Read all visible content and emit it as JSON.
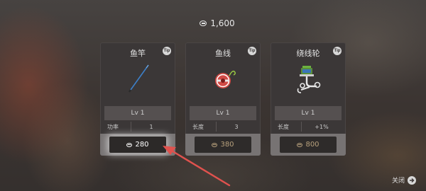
{
  "currency": {
    "icon": "coin-icon",
    "amount": "1,600"
  },
  "tip_label": "Tip",
  "cards": [
    {
      "title": "鱼竿",
      "item_icon": "fishing-rod-icon",
      "level": "Lv 1",
      "stat_name": "功率",
      "stat_value": "1",
      "cost": "280",
      "highlighted": true
    },
    {
      "title": "鱼线",
      "item_icon": "fishing-line-spool-icon",
      "level": "Lv 1",
      "stat_name": "长度",
      "stat_value": "3",
      "cost": "380",
      "highlighted": false
    },
    {
      "title": "绕线轮",
      "item_icon": "fishing-reel-icon",
      "level": "Lv 1",
      "stat_name": "长度",
      "stat_value": "+1%",
      "cost": "800",
      "highlighted": false
    }
  ],
  "close": {
    "label": "关闭",
    "icon": "arrow-right-icon"
  },
  "colors": {
    "panel": "#3b3737",
    "accent_cost": "#b7a07c",
    "pointer_arrow": "#e0524e"
  }
}
